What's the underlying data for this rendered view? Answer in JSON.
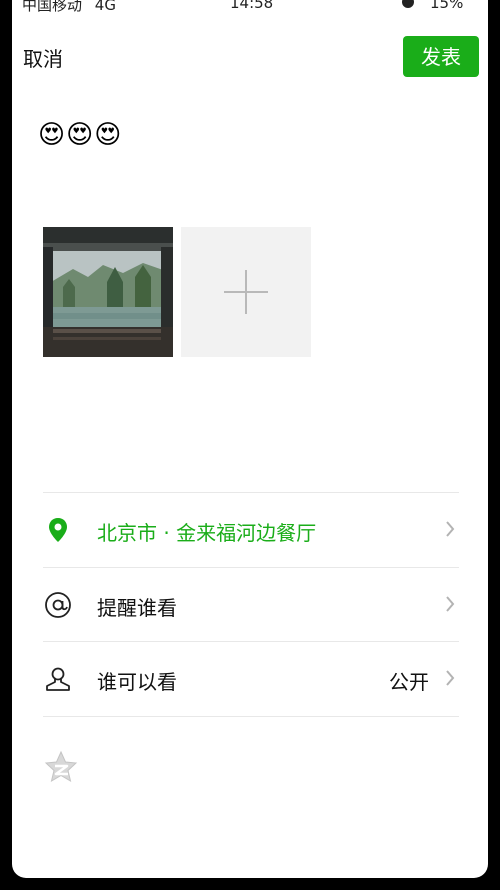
{
  "status_bar": {
    "carrier": "中国移动",
    "network": "4G",
    "time": "14:58",
    "battery": "15%"
  },
  "header": {
    "cancel_label": "取消",
    "post_label": "发表"
  },
  "post": {
    "text": "😍😍😍",
    "add_photo_icon": "plus-icon"
  },
  "options": {
    "location": {
      "icon": "location-pin-icon",
      "label": "北京市 · 金来福河边餐厅"
    },
    "mention": {
      "icon": "at-icon",
      "label": "提醒谁看"
    },
    "visibility": {
      "icon": "user-icon",
      "label": "谁可以看",
      "value": "公开"
    }
  },
  "footer": {
    "qzone_icon": "qzone-star-icon"
  },
  "colors": {
    "accent": "#1aad19",
    "divider": "#e8e8e8",
    "add_tile": "#f2f2f2"
  }
}
